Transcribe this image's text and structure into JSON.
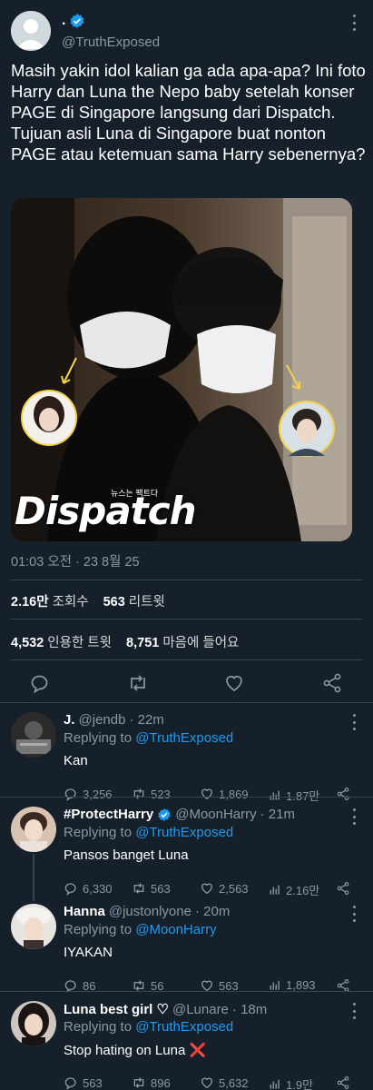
{
  "main_tweet": {
    "display_name": ".",
    "handle": "@TruthExposed",
    "text": "Masih yakin idol kalian ga ada apa-apa? Ini foto Harry dan Luna the Nepo baby setelah konser PAGE di Singapore langsung dari Dispatch. Tujuan asli Luna di Singapore buat nonton PAGE atau ketemuan sama Harry sebenernya?",
    "photo": {
      "watermark": "Dispatch",
      "watermark_small": "뉴스는 팩트다"
    },
    "timestamp": "01:03 오전 · 23 8월 25",
    "views_count": "2.16만",
    "views_label": "조회수",
    "retweets_count": "563",
    "retweets_label": "리트윗",
    "quotes_count": "4,532",
    "quotes_label": "인용한 트윗",
    "likes_count": "8,751",
    "likes_label": "마음에 들어요"
  },
  "replies": [
    {
      "name": "J.",
      "handle": "@jendb",
      "time": "· 22m",
      "replying_prefix": "Replying to",
      "replying_to": "@TruthExposed",
      "text": "Kan",
      "comments": "3,256",
      "retweets": "523",
      "likes": "1,869",
      "views": "1.87만"
    },
    {
      "name": "#ProtectHarry",
      "handle": "@MoonHarry",
      "time": "· 21m",
      "replying_prefix": "Replying to",
      "replying_to": "@TruthExposed",
      "text": "Pansos banget Luna",
      "comments": "6,330",
      "retweets": "563",
      "likes": "2,563",
      "views": "2.16만"
    },
    {
      "name": "Hanna",
      "handle": "@justonlyone",
      "time": "· 20m",
      "replying_prefix": "Replying to",
      "replying_to": "@MoonHarry",
      "text": "IYAKAN",
      "comments": "86",
      "retweets": "56",
      "likes": "563",
      "views": "1,893"
    },
    {
      "name": "Luna best girl ♡",
      "handle": "@Lunare",
      "time": "· 18m",
      "replying_prefix": "Replying to",
      "replying_to": "@TruthExposed",
      "text": "Stop hating on Luna",
      "text_emoji": "❌",
      "comments": "563",
      "retweets": "896",
      "likes": "5,632",
      "views": "1.9만"
    }
  ],
  "colors": {
    "background": "#15202b",
    "muted": "#8899a6",
    "link": "#1d9bf0",
    "divider": "#38444d",
    "verified": "#1d9bf0"
  }
}
